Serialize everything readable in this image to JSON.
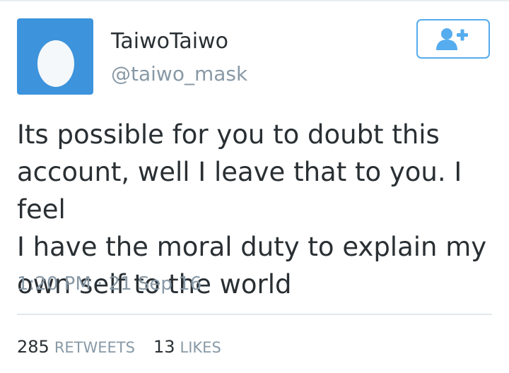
{
  "tweet": {
    "display_name": "TaiwoTaiwo",
    "handle": "@taiwo_mask",
    "avatar_icon": "default-egg-avatar",
    "avatar_color": "#3d94dc",
    "text": "Its possible for you to doubt this\naccount, well I leave that to you. I feel\nI have the moral duty to explain my\nown self to the world",
    "time": "1:20 PM",
    "separator": "·",
    "date": "21 Sep 16"
  },
  "follow_button": {
    "icon": "follow-user-plus-icon",
    "color": "#55acee"
  },
  "stats": {
    "retweets_count": "285",
    "retweets_label": "RETWEETS",
    "likes_count": "13",
    "likes_label": "LIKES"
  }
}
